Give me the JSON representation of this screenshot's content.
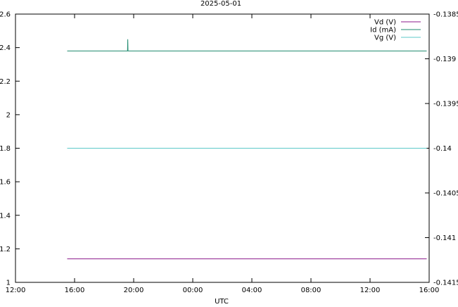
{
  "chart_data": {
    "type": "line",
    "title": "2025-05-01",
    "xlabel": "UTC",
    "ylabel": "",
    "y2label": "",
    "grid": false,
    "legend_position": "top-right",
    "x_domain": [
      "2025-05-01 12:00",
      "2025-05-02 16:00"
    ],
    "x_ticks": [
      {
        "t": "2025-05-01 12:00",
        "label": "12:00"
      },
      {
        "t": "2025-05-01 16:00",
        "label": "16:00"
      },
      {
        "t": "2025-05-01 20:00",
        "label": "20:00"
      },
      {
        "t": "2025-05-02 00:00",
        "label": "00:00"
      },
      {
        "t": "2025-05-02 04:00",
        "label": "04:00"
      },
      {
        "t": "2025-05-02 08:00",
        "label": "08:00"
      },
      {
        "t": "2025-05-02 12:00",
        "label": "12:00"
      },
      {
        "t": "2025-05-02 16:00",
        "label": "16:00"
      }
    ],
    "ylim": [
      1.0,
      2.6
    ],
    "y_ticks": [
      "1",
      "1.2",
      "1.4",
      "1.6",
      "1.8",
      "2",
      "2.2",
      "2.4",
      "2.6"
    ],
    "y2lim": [
      -0.1415,
      -0.1385
    ],
    "y2_ticks": [
      "-0.1415",
      "-0.141",
      "-0.1405",
      "-0.14",
      "-0.1395",
      "-0.139",
      "-0.1385"
    ],
    "series": [
      {
        "name": "Vd (V)",
        "axis": "y",
        "color": "#8b1a8b",
        "points": [
          {
            "t": "2025-05-01 15:30",
            "y": 1.14
          },
          {
            "t": "2025-05-02 15:50",
            "y": 1.14
          }
        ]
      },
      {
        "name": "Id (mA)",
        "axis": "y",
        "color": "#1e8a6e",
        "points": [
          {
            "t": "2025-05-01 15:30",
            "y": 2.38
          },
          {
            "t": "2025-05-01 19:35",
            "y": 2.38
          },
          {
            "t": "2025-05-01 19:36",
            "y": 2.45
          },
          {
            "t": "2025-05-01 19:37",
            "y": 2.38
          },
          {
            "t": "2025-05-02 15:50",
            "y": 2.38
          }
        ]
      },
      {
        "name": "Vg (V)",
        "axis": "y2",
        "color": "#5cc8c8",
        "points": [
          {
            "t": "2025-05-01 15:30",
            "y": -0.14
          },
          {
            "t": "2025-05-02 15:50",
            "y": -0.14
          }
        ]
      }
    ]
  }
}
